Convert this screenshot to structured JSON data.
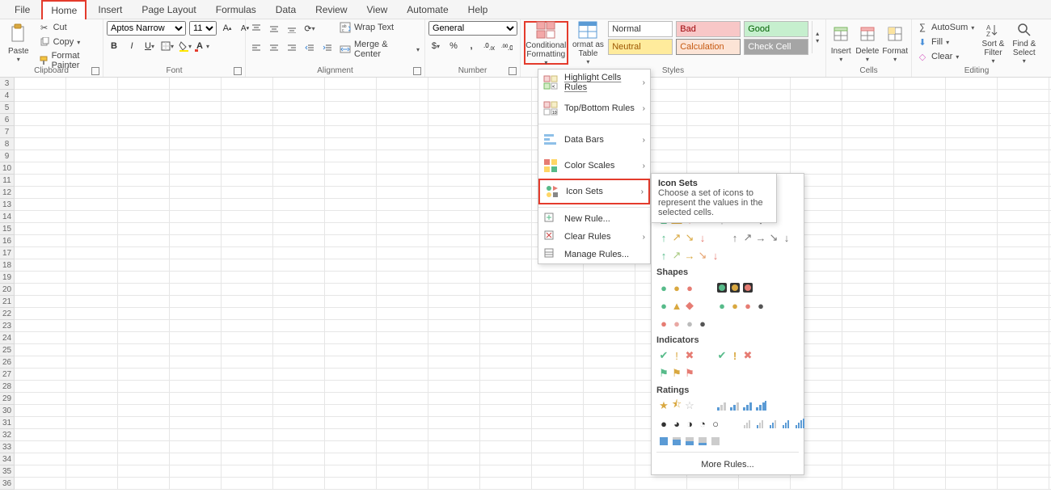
{
  "tabs": {
    "file": "File",
    "home": "Home",
    "insert": "Insert",
    "page_layout": "Page Layout",
    "formulas": "Formulas",
    "data": "Data",
    "review": "Review",
    "view": "View",
    "automate": "Automate",
    "help": "Help"
  },
  "clipboard": {
    "paste": "Paste",
    "cut": "Cut",
    "copy": "Copy",
    "painter": "Format Painter",
    "label": "Clipboard"
  },
  "font": {
    "name": "Aptos Narrow",
    "size": "11",
    "label": "Font"
  },
  "alignment": {
    "wrap": "Wrap Text",
    "merge": "Merge & Center",
    "label": "Alignment"
  },
  "number": {
    "format": "General",
    "label": "Number"
  },
  "styles": {
    "conditional": "Conditional Formatting",
    "format_as_table": "ormat as Table",
    "normal": "Normal",
    "bad": "Bad",
    "good": "Good",
    "neutral": "Neutral",
    "calculation": "Calculation",
    "check": "Check Cell",
    "label": "Styles"
  },
  "cells": {
    "insert": "Insert",
    "delete": "Delete",
    "format": "Format",
    "label": "Cells"
  },
  "editing": {
    "autosum": "AutoSum",
    "fill": "Fill",
    "clear": "Clear",
    "sort": "Sort & Filter",
    "find": "Find & Select",
    "label": "Editing"
  },
  "cf_menu": {
    "highlight": "Highlight Cells Rules",
    "topbottom": "Top/Bottom Rules",
    "databars": "Data Bars",
    "colorscales": "Color Scales",
    "iconsets": "Icon Sets",
    "newrule": "New Rule...",
    "clear": "Clear Rules",
    "manage": "Manage Rules..."
  },
  "tooltip": {
    "title": "Icon Sets",
    "body": "Choose a set of icons to represent the values in the selected cells."
  },
  "iconsets_panel": {
    "shapes": "Shapes",
    "indicators": "Indicators",
    "ratings": "Ratings",
    "more": "More Rules..."
  },
  "row_numbers": [
    3,
    4,
    5,
    6,
    7,
    8,
    9,
    10,
    11,
    12,
    13,
    14,
    15,
    16,
    17,
    18,
    19,
    20,
    21,
    22,
    23,
    24,
    25,
    26,
    27,
    28,
    29,
    30,
    31,
    32,
    33,
    34,
    35,
    36
  ]
}
